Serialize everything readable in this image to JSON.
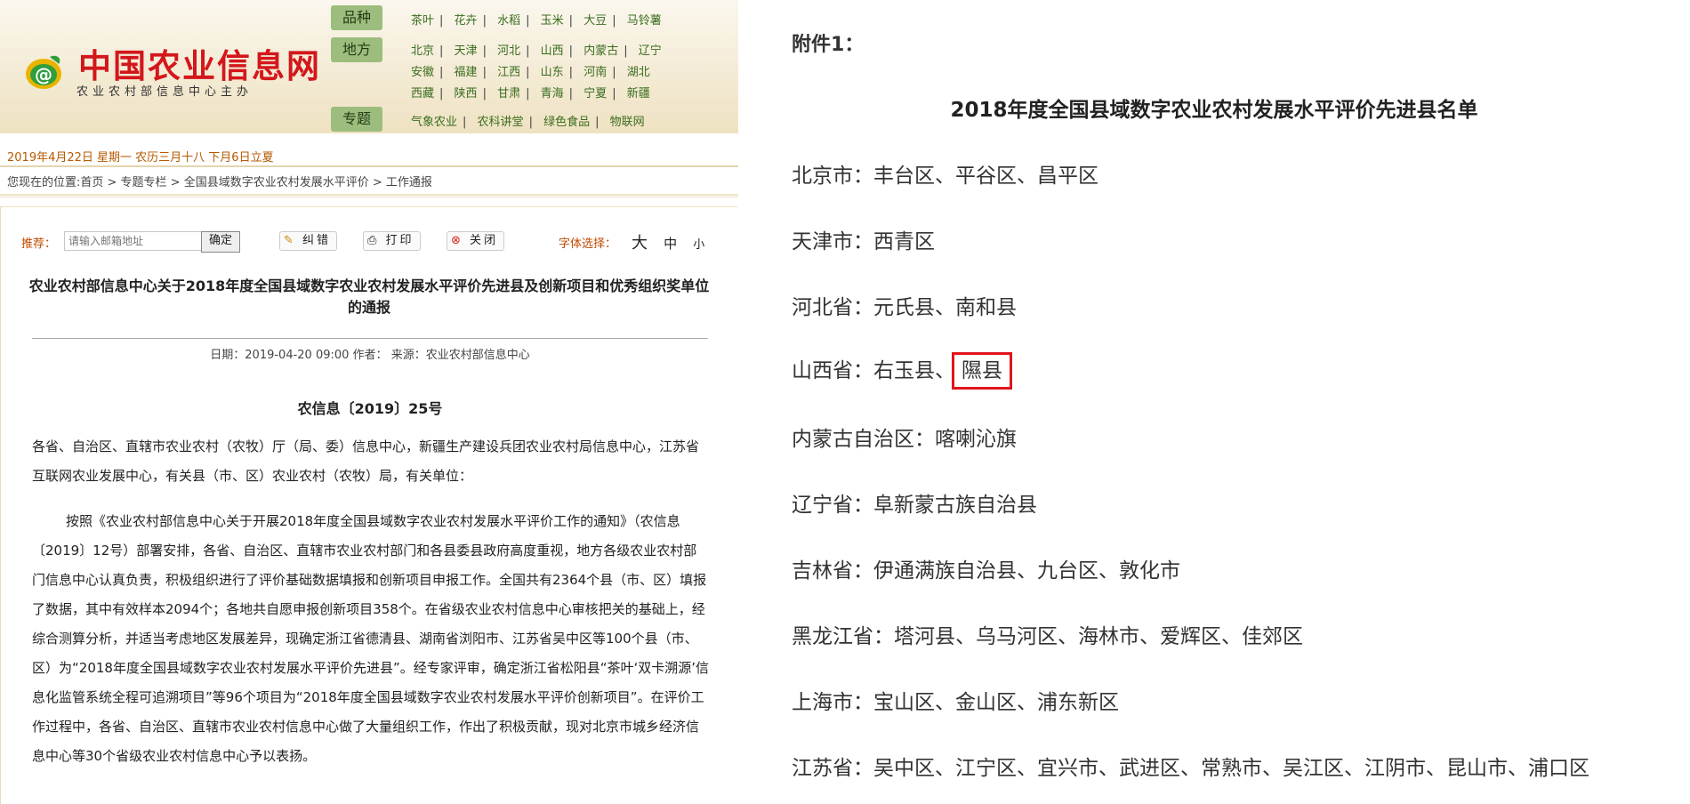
{
  "site": {
    "name": "中国农业信息网",
    "subtitle": "农业农村部信息中心主办"
  },
  "nav": {
    "categories": [
      {
        "label": "品种",
        "rows": [
          [
            "茶叶",
            "花卉",
            "水稻",
            "玉米",
            "大豆",
            "马铃薯"
          ]
        ]
      },
      {
        "label": "地方",
        "rows": [
          [
            "北京",
            "天津",
            "河北",
            "山西",
            "内蒙古",
            "辽宁"
          ],
          [
            "安徽",
            "福建",
            "江西",
            "山东",
            "河南",
            "湖北"
          ],
          [
            "西藏",
            "陕西",
            "甘肃",
            "青海",
            "宁夏",
            "新疆"
          ]
        ]
      },
      {
        "label": "专题",
        "rows": [
          [
            "气象农业",
            "农科讲堂",
            "绿色食品",
            "物联网"
          ]
        ]
      }
    ]
  },
  "dateline": "2019年4月22日 星期一 农历三月十八 下月6日立夏",
  "breadcrumb": "您现在的位置:首页 > 专题专栏 > 全国县域数字农业农村发展水平评价 > 工作通报",
  "toolbar": {
    "recommend_label": "推荐：",
    "email_placeholder": "请输入邮箱地址",
    "ok_label": "确定",
    "correct_label": "纠错",
    "print_label": "打印",
    "close_label": "关闭",
    "font_label": "字体选择：",
    "font_large": "大",
    "font_medium": "中",
    "font_small": "小"
  },
  "article": {
    "title": "农业农村部信息中心关于2018年度全国县域数字农业农村发展水平评价先进县及创新项目和优秀组织奖单位的通报",
    "meta": "日期：2019-04-20 09:00 作者：  来源：农业农村部信息中心",
    "doc_number": "农信息〔2019〕25号",
    "para1": "各省、自治区、直辖市农业农村（农牧）厅（局、委）信息中心，新疆生产建设兵团农业农村局信息中心，江苏省互联网农业发展中心，有关县（市、区）农业农村（农牧）局，有关单位：",
    "para2": "按照《农业农村部信息中心关于开展2018年度全国县域数字农业农村发展水平评价工作的通知》（农信息〔2019〕12号）部署安排，各省、自治区、直辖市农业农村部门和各县委县政府高度重视，地方各级农业农村部门信息中心认真负责，积极组织进行了评价基础数据填报和创新项目申报工作。全国共有2364个县（市、区）填报了数据，其中有效样本2094个；各地共自愿申报创新项目358个。在省级农业农村信息中心审核把关的基础上，经综合测算分析，并适当考虑地区发展差异，现确定浙江省德清县、湖南省浏阳市、江苏省吴中区等100个县（市、区）为“2018年度全国县域数字农业农村发展水平评价先进县”。经专家评审，确定浙江省松阳县“茶叶‘双卡溯源’信息化监管系统全程可追溯项目”等96个项目为“2018年度全国县域数字农业农村发展水平评价创新项目”。在评价工作过程中，各省、自治区、直辖市农业农村信息中心做了大量组织工作，作出了积极贡献，现对北京市城乡经济信息中心等30个省级农业农村信息中心予以表扬。"
  },
  "attachment": {
    "label": "附件1：",
    "title": "2018年度全国县域数字农业农村发展水平评价先进县名单",
    "entries": [
      {
        "province": "北京市：",
        "counties": "丰台区、平谷区、昌平区"
      },
      {
        "province": "天津市：",
        "counties": "西青区"
      },
      {
        "province": "河北省：",
        "counties": "元氏县、南和县"
      },
      {
        "province": "山西省：",
        "counties": "右玉县、",
        "highlight": "隰县"
      },
      {
        "province": "内蒙古自治区：",
        "counties": "喀喇沁旗"
      },
      {
        "province": "辽宁省：",
        "counties": "阜新蒙古族自治县"
      },
      {
        "province": "吉林省：",
        "counties": "伊通满族自治县、九台区、敦化市"
      },
      {
        "province": "黑龙江省：",
        "counties": "塔河县、乌马河区、海林市、爱辉区、佳郊区"
      },
      {
        "province": "上海市：",
        "counties": "宝山区、金山区、浦东新区"
      },
      {
        "province": "江苏省：",
        "counties": "吴中区、江宁区、宜兴市、武进区、常熟市、吴江区、江阴市、昆山市、浦口区"
      }
    ]
  }
}
